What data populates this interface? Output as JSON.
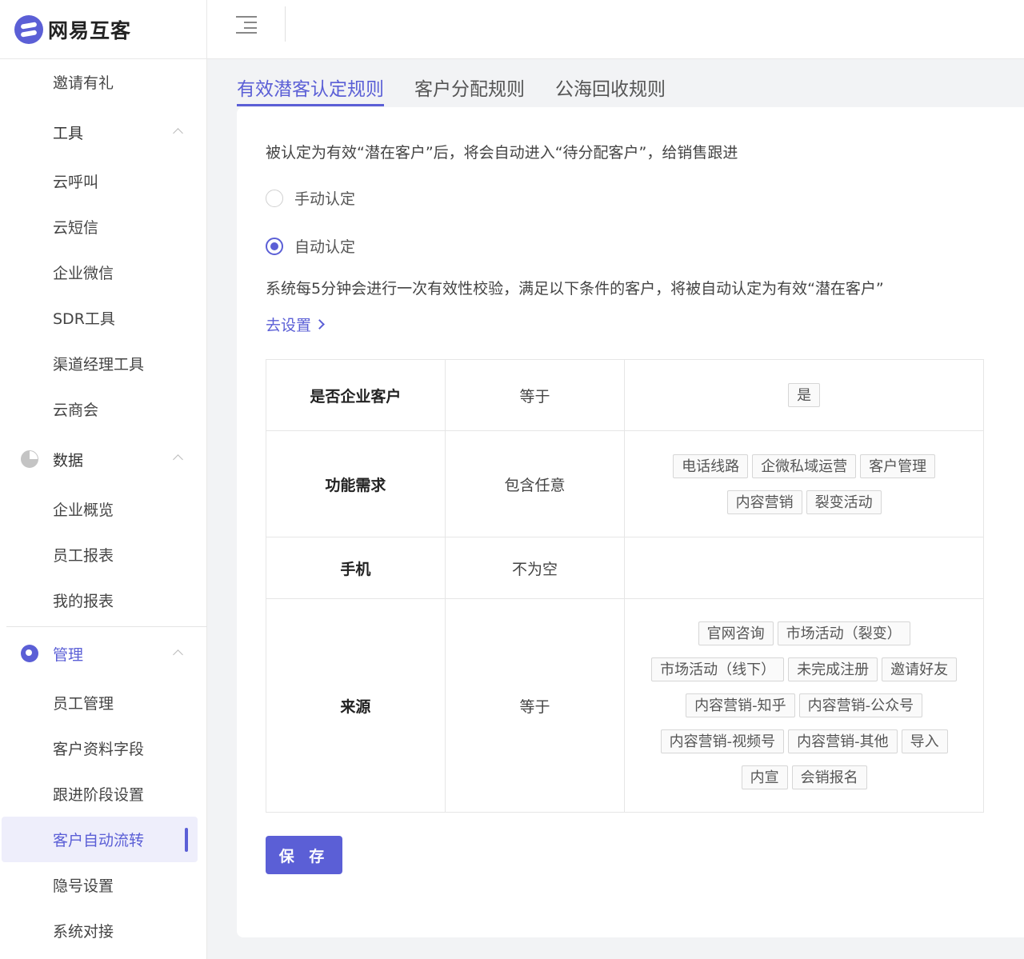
{
  "brand": {
    "name": "网易互客"
  },
  "sidebar": {
    "top_items": [
      {
        "label": "邀请有礼"
      }
    ],
    "groups": [
      {
        "label": "工具",
        "items": [
          "云呼叫",
          "云短信",
          "企业微信",
          "SDR工具",
          "渠道经理工具",
          "云商会"
        ]
      },
      {
        "label": "数据",
        "items": [
          "企业概览",
          "员工报表",
          "我的报表"
        ]
      },
      {
        "label": "管理",
        "items": [
          "员工管理",
          "客户资料字段",
          "跟进阶段设置",
          "客户自动流转",
          "隐号设置",
          "系统对接"
        ],
        "selected": "客户自动流转"
      }
    ]
  },
  "tabs": [
    "有效潜客认定规则",
    "客户分配规则",
    "公海回收规则"
  ],
  "active_tab": "有效潜客认定规则",
  "content": {
    "description": "被认定为有效“潜在客户”后，将会自动进入“待分配客户”，给销售跟进",
    "radio_manual": "手动认定",
    "radio_auto": "自动认定",
    "selected_mode": "自动认定",
    "system_note": "系统每5分钟会进行一次有效性校验，满足以下条件的客户，将被自动认定为有效“潜在客户”",
    "settings_link": "去设置",
    "rules": [
      {
        "field": "是否企业客户",
        "operator": "等于",
        "values": [
          "是"
        ]
      },
      {
        "field": "功能需求",
        "operator": "包含任意",
        "values": [
          "电话线路",
          "企微私域运营",
          "客户管理",
          "内容营销",
          "裂变活动"
        ]
      },
      {
        "field": "手机",
        "operator": "不为空",
        "values": []
      },
      {
        "field": "来源",
        "operator": "等于",
        "values": [
          "官网咨询",
          "市场活动（裂变）",
          "市场活动（线下）",
          "未完成注册",
          "邀请好友",
          "内容营销-知乎",
          "内容营销-公众号",
          "内容营销-视频号",
          "内容营销-其他",
          "导入",
          "内宣",
          "会销报名"
        ]
      }
    ],
    "save_label": "保 存"
  },
  "colors": {
    "accent": "#5b5fd6"
  }
}
